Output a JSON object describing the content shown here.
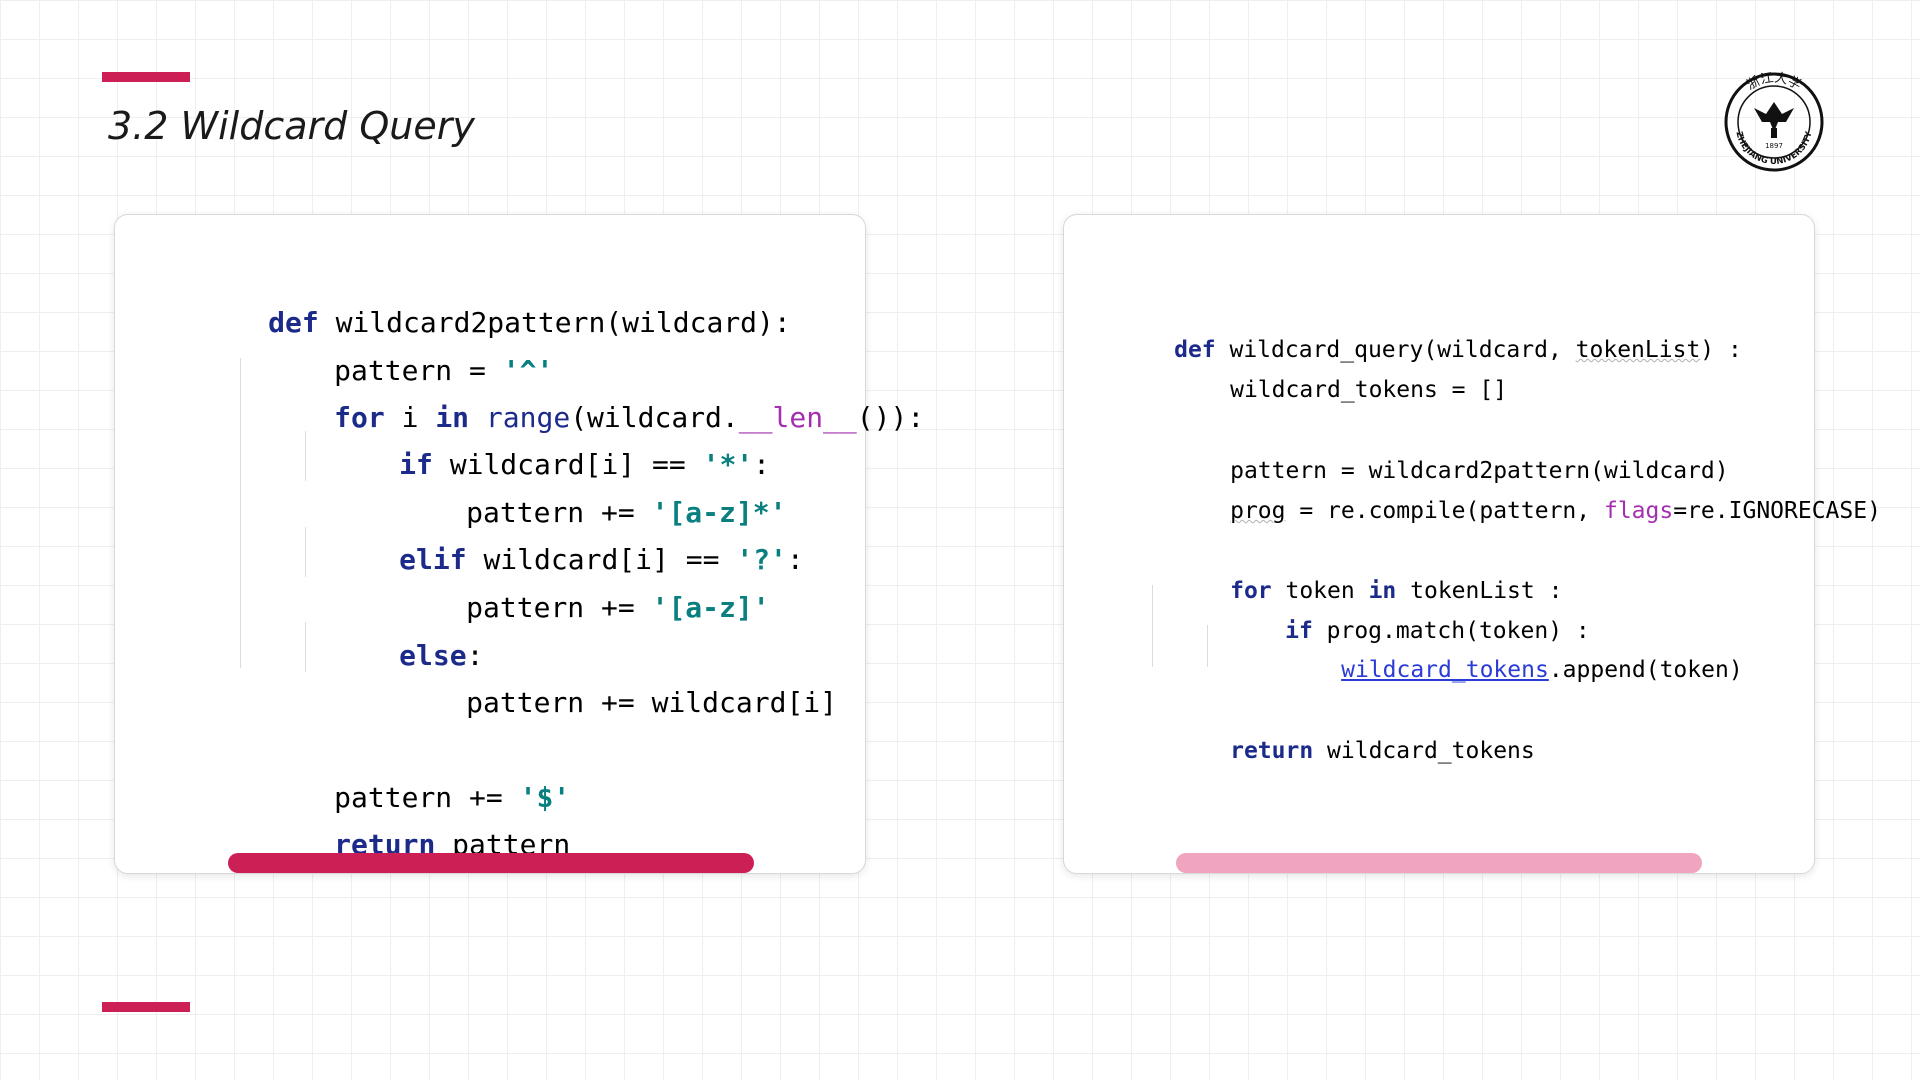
{
  "colors": {
    "accent": "#cc1f56",
    "accent_light": "#f0a4c0",
    "keyword": "#1c2b8a",
    "string": "#0a7f7f",
    "magic": "#a52fb0",
    "link": "#2a3bd6"
  },
  "slide": {
    "title_number": "3.2",
    "title_text": "Wildcard Query",
    "logo": {
      "icon": "zhejiang-university-logo",
      "year": "1897",
      "name": "ZHEJIANG UNIVERSITY",
      "chinese": "浙江大学"
    }
  },
  "left_code": {
    "l1": {
      "kw": "def",
      "rest": " wildcard2pattern(wildcard):"
    },
    "l2": {
      "a": "pattern = ",
      "str": "'^'"
    },
    "l3": {
      "kw1": "for",
      "a": " i ",
      "kw2": "in",
      "b": " ",
      "bi": "range",
      "c": "(wildcard.",
      "dunder": "__len__",
      "d": "()):"
    },
    "l4": {
      "kw": "if",
      "a": " wildcard[i] == ",
      "str": "'*'",
      "b": ":"
    },
    "l5": {
      "a": "pattern += ",
      "str": "'[a-z]*'"
    },
    "l6": {
      "kw": "elif",
      "a": " wildcard[i] == ",
      "str": "'?'",
      "b": ":"
    },
    "l7": {
      "a": "pattern += ",
      "str": "'[a-z]'"
    },
    "l8": {
      "kw": "else",
      "a": ":"
    },
    "l9": {
      "a": "pattern += wildcard[i]"
    },
    "l10": {
      "a": "pattern += ",
      "str": "'$'"
    },
    "l11": {
      "kw": "return",
      "a": " pattern"
    }
  },
  "right_code": {
    "l1": {
      "kw": "def",
      "a": " wildcard_query(wildcard, ",
      "b": "tokenList",
      "c": ") :"
    },
    "l2": {
      "a": "wildcard_tokens = []"
    },
    "l3": {
      "a": "pattern = wildcard2pattern(wildcard)"
    },
    "l4": {
      "a": "prog",
      "b": " = re.compile(pattern, ",
      "kwarg": "flags",
      "c": "=re.IGNORECASE)"
    },
    "l5": {
      "kw1": "for",
      "a": " token ",
      "kw2": "in",
      "b": " tokenList : "
    },
    "l6": {
      "kw": "if",
      "a": " prog.match(token) : "
    },
    "l7": {
      "link": "wildcard_tokens",
      "a": ".append(token)"
    },
    "l8": {
      "kw": "return",
      "a": " wildcard_tokens"
    }
  }
}
